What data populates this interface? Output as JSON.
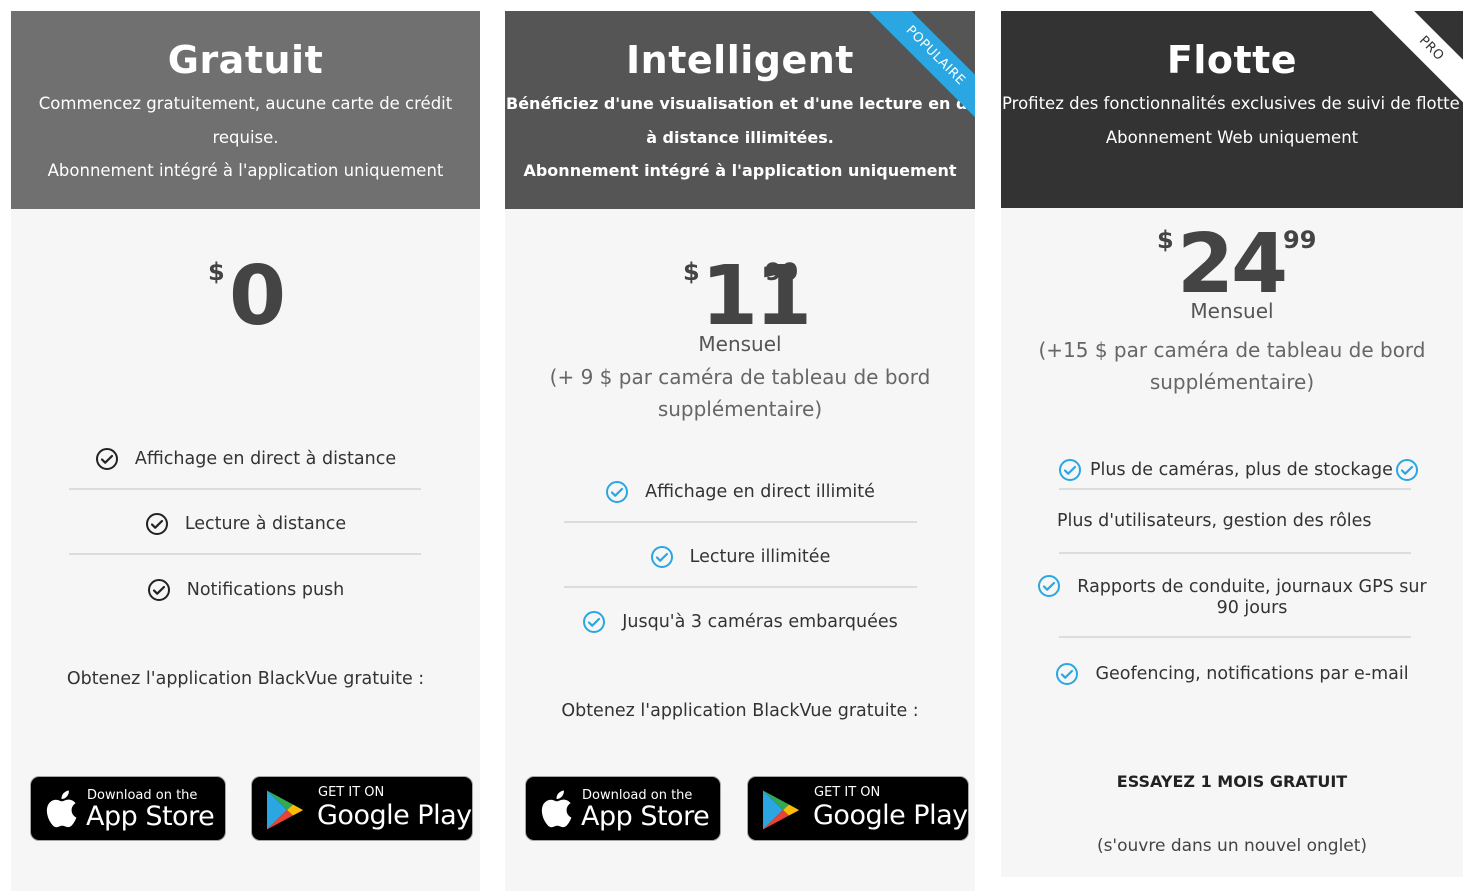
{
  "plans": {
    "free": {
      "title": "Gratuit",
      "desc": [
        "Commencez gratuitement, aucune carte de crédit",
        "requise.",
        "Abonnement intégré à l'application uniquement"
      ],
      "currency": "$",
      "price": "0",
      "features": [
        "Affichage en direct à distance",
        "Lecture à distance",
        "Notifications push"
      ],
      "get_app": "Obtenez l'application BlackVue gratuite :"
    },
    "smart": {
      "title": "Intelligent",
      "badge": "POPULAIRE",
      "desc": [
        "Bénéficiez d'une visualisation et d'une lecture en direct",
        "à distance illimitées.",
        "Abonnement intégré à l'application uniquement"
      ],
      "currency": "$",
      "price": "11",
      "cents": "99",
      "period": "Mensuel",
      "extra": [
        "(+ 9 $ par caméra de tableau de bord",
        "supplémentaire)"
      ],
      "features": [
        "Affichage en direct illimité",
        "Lecture illimitée",
        "Jusqu'à 3 caméras embarquées"
      ],
      "get_app": "Obtenez l'application BlackVue gratuite :"
    },
    "fleet": {
      "title": "Flotte",
      "badge": "PRO",
      "desc": [
        "Profitez des fonctionnalités exclusives de suivi de flotte",
        "Abonnement Web uniquement"
      ],
      "currency": "$",
      "price": "24",
      "cents": "99",
      "period": "Mensuel",
      "extra": [
        "(+15 $ par caméra de tableau de bord",
        "supplémentaire)"
      ],
      "features": [
        "Plus de caméras, plus de stockage",
        "Plus d'utilisateurs, gestion des rôles",
        "Rapports de conduite, journaux GPS sur",
        "90 jours",
        "Geofencing, notifications par e-mail"
      ],
      "cta": "ESSAYEZ 1 MOIS GRATUIT",
      "cta_note": "(s'ouvre dans un nouvel onglet)"
    }
  },
  "badges": {
    "app_store_small": "Download on the",
    "app_store_big": "App Store",
    "google_small": "GET IT ON",
    "google_big": "Google Play"
  },
  "colors": {
    "header_free": "#707070",
    "header_smart": "#555555",
    "header_fleet": "#333333",
    "accent": "#2aa7e2",
    "card_bg": "#f6f6f6"
  },
  "icons": {
    "check_dark": "check-circle-icon",
    "check_blue": "check-circle-icon",
    "apple": "apple-icon",
    "google_play": "google-play-icon"
  }
}
